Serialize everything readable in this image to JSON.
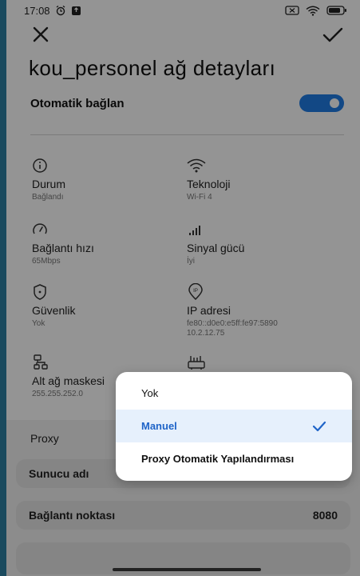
{
  "status_bar": {
    "time": "17:08",
    "icons": [
      "alarm-icon",
      "notification-icon",
      "battery-saver-icon",
      "wifi-icon",
      "battery-icon"
    ]
  },
  "header": {
    "close_icon": "close-icon",
    "confirm_icon": "check-icon",
    "title": "kou_personel ağ detayları"
  },
  "auto_connect": {
    "label": "Otomatik bağlan",
    "enabled": true,
    "accent": "#1f7de6"
  },
  "details": [
    {
      "icon": "info-icon",
      "label": "Durum",
      "value": "Bağlandı"
    },
    {
      "icon": "wifi-icon",
      "label": "Teknoloji",
      "value": "Wi-Fi 4"
    },
    {
      "icon": "speedometer-icon",
      "label": "Bağlantı hızı",
      "value": "65Mbps"
    },
    {
      "icon": "signal-icon",
      "label": "Sinyal gücü",
      "value": "İyi"
    },
    {
      "icon": "shield-icon",
      "label": "Güvenlik",
      "value": "Yok"
    },
    {
      "icon": "ip-icon",
      "label": "IP adresi",
      "value": "fe80::d0e0:e5ff:fe97:5890",
      "value2": "10.2.12.75"
    },
    {
      "icon": "network-icon",
      "label": "Alt ağ maskesi",
      "value": "255.255.252.0"
    },
    {
      "icon": "router-icon",
      "label": "",
      "value": ""
    }
  ],
  "proxy": {
    "label": "Proxy",
    "server_label": "Sunucu adı",
    "port_label": "Bağlantı noktası",
    "port_value": "8080"
  },
  "proxy_dropdown": {
    "options": [
      "Yok",
      "Manuel",
      "Proxy Otomatik Yapılandırması"
    ],
    "selected": "Manuel",
    "selected_color": "#1f64c8"
  }
}
